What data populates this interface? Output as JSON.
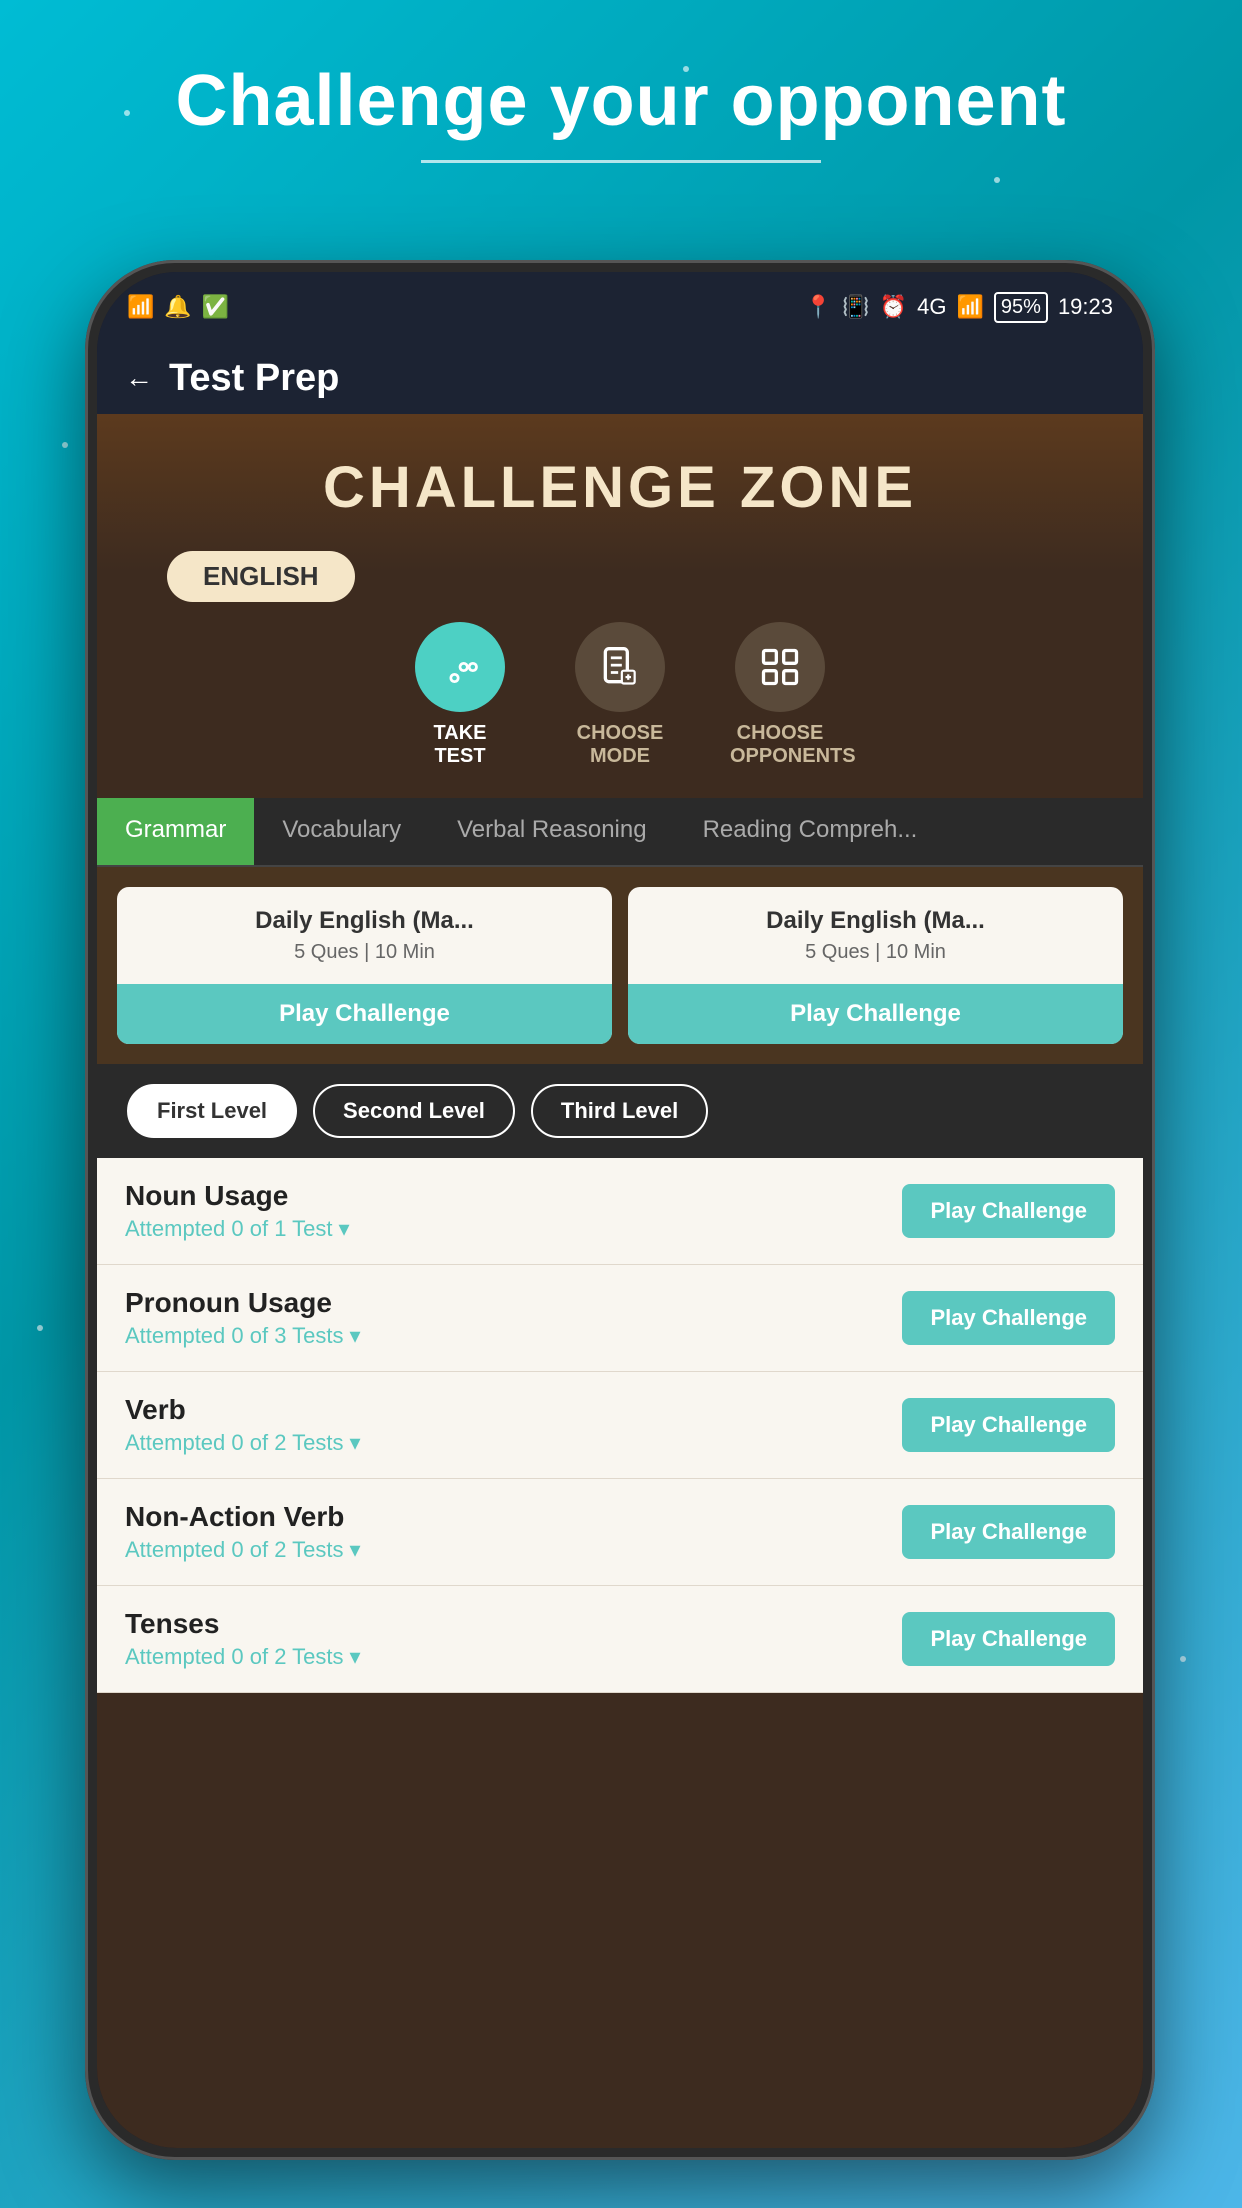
{
  "page": {
    "background_title": "Challenge your opponent",
    "status_bar": {
      "time": "19:23",
      "battery": "95%",
      "signal": "4G"
    },
    "nav": {
      "back_label": "←",
      "title": "Test Prep"
    },
    "challenge_zone": {
      "title": "CHALLENGE ZONE",
      "subject_badge": "ENGLISH"
    },
    "action_icons": [
      {
        "id": "take-test",
        "label": "TAKE TEST",
        "active": true
      },
      {
        "id": "choose-mode",
        "label": "CHOOSE MODE",
        "active": false
      },
      {
        "id": "choose-opponents",
        "label": "CHOOSE OPPONENTS",
        "active": false
      }
    ],
    "tabs": [
      {
        "id": "grammar",
        "label": "Grammar",
        "active": true
      },
      {
        "id": "vocabulary",
        "label": "Vocabulary",
        "active": false
      },
      {
        "id": "verbal-reasoning",
        "label": "Verbal Reasoning",
        "active": false
      },
      {
        "id": "reading-comprehension",
        "label": "Reading Compreh...",
        "active": false
      }
    ],
    "daily_cards": [
      {
        "title": "Daily English (Ma...",
        "subtitle": "5 Ques | 10 Min",
        "btn": "Play Challenge"
      },
      {
        "title": "Daily English (Ma...",
        "subtitle": "5 Ques | 10 Min",
        "btn": "Play Challenge"
      }
    ],
    "levels": [
      {
        "label": "First Level",
        "active": true
      },
      {
        "label": "Second Level",
        "active": false
      },
      {
        "label": "Third Level",
        "active": false
      }
    ],
    "topics": [
      {
        "name": "Noun Usage",
        "attempt": "Attempted 0 of 1 Test",
        "btn": "Play Challenge"
      },
      {
        "name": "Pronoun Usage",
        "attempt": "Attempted 0 of 3 Tests",
        "btn": "Play Challenge"
      },
      {
        "name": "Verb",
        "attempt": "Attempted 0 of 2 Tests",
        "btn": "Play Challenge"
      },
      {
        "name": "Non-Action Verb",
        "attempt": "Attempted 0 of 2 Tests",
        "btn": "Play Challenge"
      },
      {
        "name": "Tenses",
        "attempt": "Attempted 0 of 2 Tests",
        "btn": "Play Challenge"
      }
    ]
  }
}
